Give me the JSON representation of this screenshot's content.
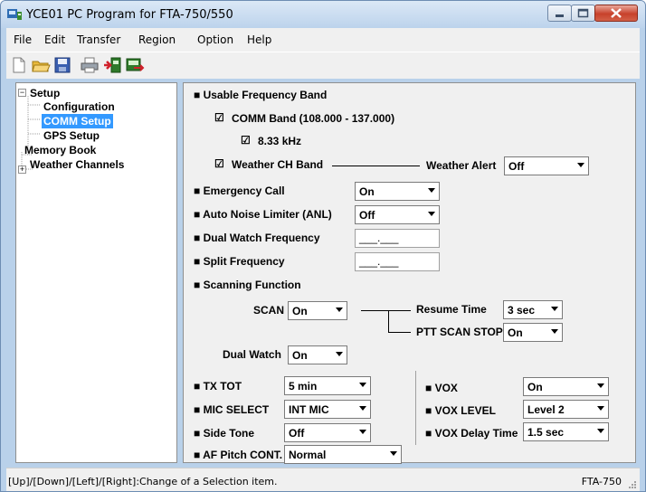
{
  "window": {
    "title": "YCE01 PC Program for FTA-750/550",
    "app_icon": "radio-app-icon",
    "controls": {
      "minimize_icon": "minimize-icon",
      "maximize_icon": "maximize-icon",
      "close_icon": "close-icon"
    }
  },
  "menu": [
    "File",
    "Edit",
    "Transfer",
    "Region",
    "Option",
    "Help"
  ],
  "toolbar": {
    "icons": [
      "new-document-icon",
      "open-folder-icon",
      "save-disk-icon",
      "print-icon",
      "read-from-radio-icon",
      "write-to-radio-icon"
    ]
  },
  "tree": {
    "setup_label": "Setup",
    "setup_expander": "−",
    "configuration_label": "Configuration",
    "comm_setup_label": "COMM Setup",
    "gps_setup_label": "GPS Setup",
    "memory_book_label": "Memory Book",
    "weather_channels_label": "Weather Channels",
    "weather_expander": "+"
  },
  "form": {
    "usable_band_heading": "■ Usable Frequency Band",
    "comm_band_label": "COMM Band (108.000 - 137.000)",
    "comm_band_checked": true,
    "khz_label": "8.33 kHz",
    "khz_checked": true,
    "weather_ch_band_label": "Weather CH Band",
    "weather_ch_band_checked": true,
    "weather_alert_label": "Weather Alert",
    "weather_alert_value": "Off",
    "emergency_call_label": "■ Emergency Call",
    "emergency_call_value": "On",
    "anl_label": "■ Auto Noise Limiter (ANL)",
    "anl_value": "Off",
    "dual_watch_freq_label": "■ Dual Watch Frequency",
    "dual_watch_freq_value": "___.___",
    "split_freq_label": "■ Split Frequency",
    "split_freq_value": "___.___",
    "scanning_function_label": "■ Scanning Function",
    "scan_label": "SCAN",
    "scan_value": "On",
    "resume_time_label": "Resume Time",
    "resume_time_value": "3 sec",
    "ptt_scan_stop_label": "PTT SCAN STOP",
    "ptt_scan_stop_value": "On",
    "dual_watch_label": "Dual Watch",
    "dual_watch_value": "On",
    "tx_tot_label": "■ TX TOT",
    "tx_tot_value": "5 min",
    "mic_select_label": "■ MIC SELECT",
    "mic_select_value": "INT MIC",
    "side_tone_label": "■ Side Tone",
    "side_tone_value": "Off",
    "af_pitch_label": "■ AF Pitch CONT.",
    "af_pitch_value": "Normal",
    "vox_label": "■ VOX",
    "vox_value": "On",
    "vox_level_label": "■ VOX LEVEL",
    "vox_level_value": "Level 2",
    "vox_delay_label": "■ VOX Delay Time",
    "vox_delay_value": "1.5 sec"
  },
  "status": {
    "hint": "[Up]/[Down]/[Left]/[Right]:Change of a Selection item.",
    "model": "FTA-750"
  },
  "colors": {
    "selection": "#3399ff",
    "frame": "#b9d1ea",
    "panel": "#f0f0f0"
  }
}
